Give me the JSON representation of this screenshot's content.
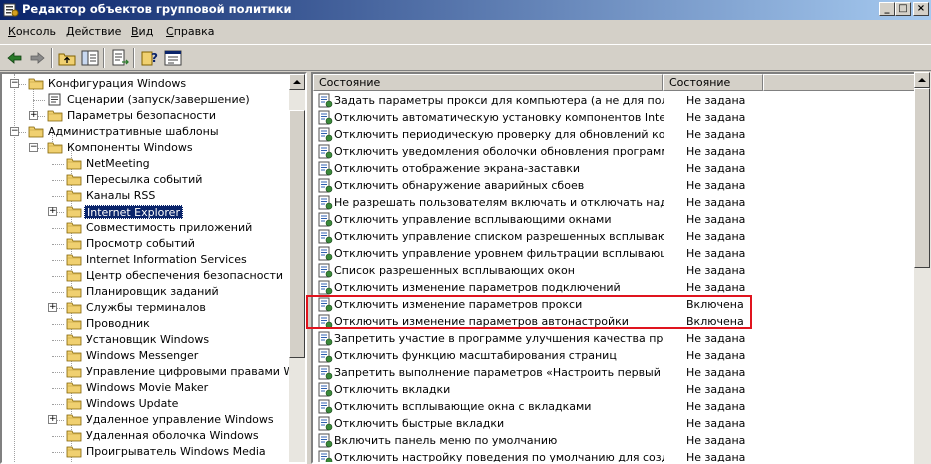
{
  "window": {
    "title": "Редактор объектов групповой политики",
    "buttons": {
      "minimize": "_",
      "maximize": "□",
      "close": "×"
    }
  },
  "menu": {
    "items": [
      {
        "label": "Консоль",
        "underline": "К"
      },
      {
        "label": "Действие",
        "underline": "Д"
      },
      {
        "label": "Вид",
        "underline": "В"
      },
      {
        "label": "Справка",
        "underline": "С"
      }
    ]
  },
  "toolbar": {
    "icons": [
      "back-icon",
      "forward-icon",
      "up-folder-icon",
      "show-hide-tree-icon",
      "export-list-icon",
      "help-icon",
      "properties-icon"
    ]
  },
  "tree": {
    "nodes": [
      {
        "label": "Конфигурация Windows",
        "expander": "−"
      },
      {
        "label": "Сценарии (запуск/завершение)",
        "icon": "script-icon"
      },
      {
        "label": "Параметры безопасности",
        "expander": "+"
      },
      {
        "label": "Административные шаблоны",
        "expander": "−"
      },
      {
        "label": "Компоненты Windows",
        "expander": "−"
      },
      {
        "label": "NetMeeting"
      },
      {
        "label": "Пересылка событий"
      },
      {
        "label": "Каналы RSS"
      },
      {
        "label": "Internet Explorer",
        "expander": "+",
        "selected": true
      },
      {
        "label": "Совместимость приложений"
      },
      {
        "label": "Просмотр событий"
      },
      {
        "label": "Internet Information Services"
      },
      {
        "label": "Центр обеспечения безопасности"
      },
      {
        "label": "Планировщик заданий"
      },
      {
        "label": "Службы терминалов",
        "expander": "+"
      },
      {
        "label": "Проводник"
      },
      {
        "label": "Установщик Windows"
      },
      {
        "label": "Windows Messenger"
      },
      {
        "label": "Управление цифровыми правами Windows"
      },
      {
        "label": "Windows Movie Maker"
      },
      {
        "label": "Windows Update"
      },
      {
        "label": "Удаленное управление Windows",
        "expander": "+"
      },
      {
        "label": "Удаленная оболочка Windows"
      },
      {
        "label": "Проигрыватель Windows Media"
      }
    ]
  },
  "list": {
    "columns": [
      "Состояние",
      "Состояние"
    ],
    "rows": [
      {
        "name": "Задать параметры прокси для компьютера (а не для пользо...",
        "state": "Не задана"
      },
      {
        "name": "Отключить автоматическую установку компонентов Interne...",
        "state": "Не задана"
      },
      {
        "name": "Отключить периодическую проверку для обновлений компо...",
        "state": "Не задана"
      },
      {
        "name": "Отключить уведомления оболочки обновления программ при...",
        "state": "Не задана"
      },
      {
        "name": "Отключить отображение экрана-заставки",
        "state": "Не задана"
      },
      {
        "name": "Отключить обнаружение аварийных сбоев",
        "state": "Не задана"
      },
      {
        "name": "Не разрешать пользователям включать и отключать надстр...",
        "state": "Не задана"
      },
      {
        "name": "Отключить управление всплывающими окнами",
        "state": "Не задана"
      },
      {
        "name": "Отключить управление списком разрешенных всплывающих...",
        "state": "Не задана"
      },
      {
        "name": "Отключить управление уровнем фильтрации всплывающих ...",
        "state": "Не задана"
      },
      {
        "name": "Список разрешенных всплывающих окон",
        "state": "Не задана"
      },
      {
        "name": "Отключить изменение параметров подключений",
        "state": "Не задана"
      },
      {
        "name": "Отключить изменение параметров прокси",
        "state": "Включена"
      },
      {
        "name": "Отключить изменение параметров автонастройки",
        "state": "Включена"
      },
      {
        "name": "Запретить участие в программе улучшения качества програ...",
        "state": "Не задана"
      },
      {
        "name": "Отключить функцию масштабирования страниц",
        "state": "Не задана"
      },
      {
        "name": "Запретить выполнение параметров «Настроить первый запу...",
        "state": "Не задана"
      },
      {
        "name": "Отключить вкладки",
        "state": "Не задана"
      },
      {
        "name": "Отключить всплывающие окна с вкладками",
        "state": "Не задана"
      },
      {
        "name": "Отключить быстрые вкладки",
        "state": "Не задана"
      },
      {
        "name": "Включить панель меню по умолчанию",
        "state": "Не задана"
      },
      {
        "name": "Отключить настройку поведения по умолчанию для создани...",
        "state": "Не задана"
      }
    ]
  },
  "colors": {
    "title_gradient_start": "#0a246a",
    "title_gradient_end": "#a6caf0",
    "selection": "#0a246a",
    "annotation_box": "#e0141e",
    "folder": "#f0d070"
  }
}
